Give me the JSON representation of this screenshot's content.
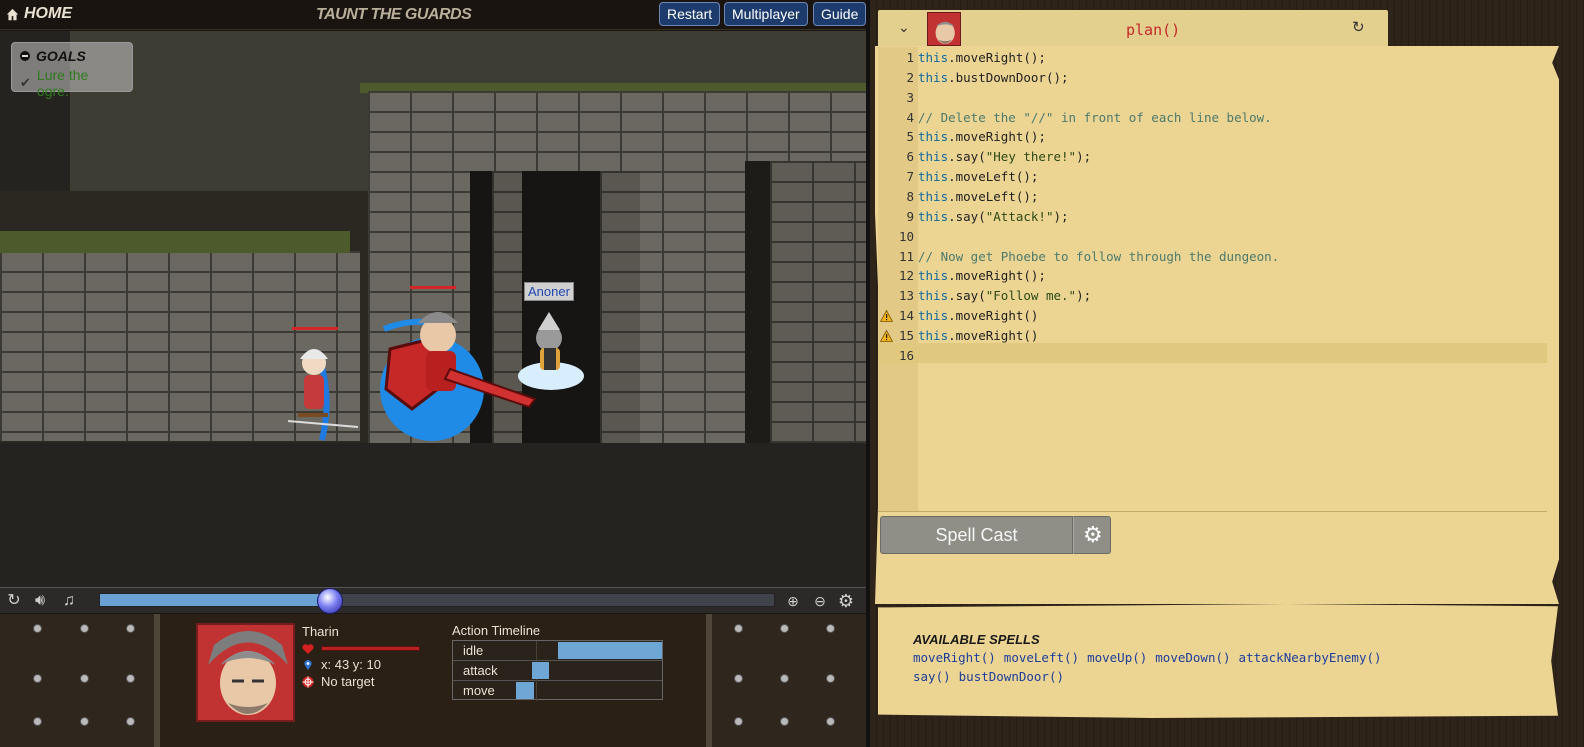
{
  "topbar": {
    "home_label": "HOME",
    "level_title": "TAUNT THE GUARDS",
    "buttons": {
      "restart": "Restart",
      "multiplayer": "Multiplayer",
      "guide": "Guide"
    }
  },
  "goals": {
    "title": "GOALS",
    "items": [
      "Lure the ogre."
    ]
  },
  "world": {
    "ally_name": "Anoner"
  },
  "playback": {
    "progress": 0.34
  },
  "status": {
    "hero_name": "Tharin",
    "position": "x: 43 y: 10",
    "target": "No target",
    "hp_fraction": 1.0,
    "timeline_label": "Action Timeline",
    "timeline": [
      {
        "action": "idle",
        "segments": [
          [
            0.5,
            1.0
          ]
        ]
      },
      {
        "action": "attack",
        "segments": [
          [
            0.38,
            0.46
          ]
        ]
      },
      {
        "action": "move",
        "segments": [
          [
            0.3,
            0.39
          ]
        ]
      }
    ]
  },
  "editor": {
    "method": "plan()",
    "lines": [
      "this.moveRight();",
      "this.bustDownDoor();",
      "",
      "// Delete the \"//\" in front of each line below.",
      "this.moveRight();",
      "this.say(\"Hey there!\");",
      "this.moveLeft();",
      "this.moveLeft();",
      "this.say(\"Attack!\");",
      "",
      "// Now get Phoebe to follow through the dungeon.",
      "this.moveRight();",
      "this.say(\"Follow me.\");",
      "this.moveRight()",
      "this.moveRight()",
      ""
    ],
    "warning_lines": [
      14,
      15
    ],
    "active_line": 16,
    "spell_cast_label": "Spell Cast"
  },
  "spells": {
    "title": "AVAILABLE SPELLS",
    "items": [
      "moveRight()",
      "moveLeft()",
      "moveUp()",
      "moveDown()",
      "attackNearbyEnemy()",
      "say()",
      "bustDownDoor()"
    ]
  },
  "colors": {
    "accent_blue": "#6ea6d6",
    "button_blue": "#1d3c6d",
    "parchment": "#ecd493",
    "method_red": "#c42a2a",
    "keyword": "#0c6aa2",
    "goal_green": "#2f7a1d"
  }
}
